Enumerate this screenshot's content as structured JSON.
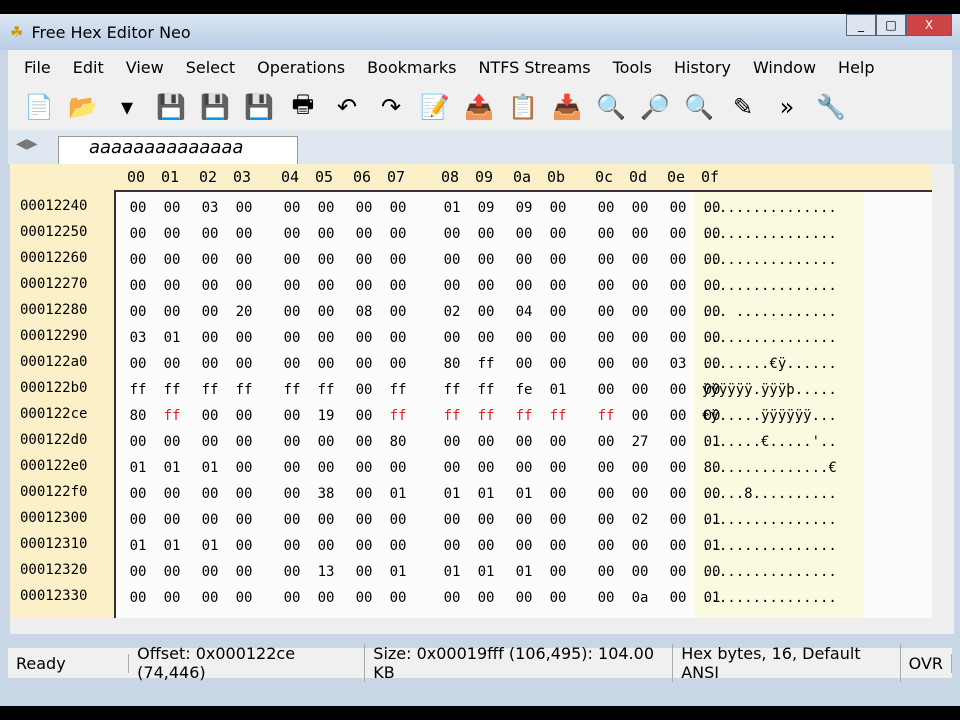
{
  "window": {
    "title": "Free Hex Editor Neo",
    "controls": [
      "_",
      "□",
      "X"
    ]
  },
  "menu": [
    "File",
    "Edit",
    "View",
    "Select",
    "Operations",
    "Bookmarks",
    "NTFS Streams",
    "Tools",
    "History",
    "Window",
    "Help"
  ],
  "toolbar": {
    "icons": [
      "new-file-icon",
      "open-folder-icon",
      "dropdown-icon",
      "save-icon",
      "save-as-icon",
      "save-all-icon",
      "print-icon",
      "undo-icon",
      "redo-icon",
      "edit-icon",
      "export-icon",
      "paste-icon",
      "import-icon",
      "find-icon",
      "find-next-icon",
      "replace-icon",
      "pen-icon",
      "more-icon",
      "settings-icon"
    ],
    "overflow": "»"
  },
  "tab": {
    "label": "aaaaaaaaaaaaaa"
  },
  "columns": [
    "00",
    "01",
    "02",
    "03",
    "04",
    "05",
    "06",
    "07",
    "08",
    "09",
    "0a",
    "0b",
    "0c",
    "0d",
    "0e",
    "0f"
  ],
  "rows": [
    {
      "addr": "00012240",
      "bytes": "00 00 03 00 00 00 00 00 01 09 09 00 00 00 00 00",
      "ascii": "................"
    },
    {
      "addr": "00012250",
      "bytes": "00 00 00 00 00 00 00 00 00 00 00 00 00 00 00 00",
      "ascii": "................"
    },
    {
      "addr": "00012260",
      "bytes": "00 00 00 00 00 00 00 00 00 00 00 00 00 00 00 00",
      "ascii": "................"
    },
    {
      "addr": "00012270",
      "bytes": "00 00 00 00 00 00 00 00 00 00 00 00 00 00 00 00",
      "ascii": "................"
    },
    {
      "addr": "00012280",
      "bytes": "00 00 00 20 00 00 08 00 02 00 04 00 00 00 00 00",
      "ascii": "... ............"
    },
    {
      "addr": "00012290",
      "bytes": "03 01 00 00 00 00 00 00 00 00 00 00 00 00 00 00",
      "ascii": "................"
    },
    {
      "addr": "000122a0",
      "bytes": "00 00 00 00 00 00 00 00 80 ff 00 00 00 00 03 00",
      "ascii": "........€ÿ......"
    },
    {
      "addr": "000122b0",
      "bytes": "ff ff ff ff ff ff 00 ff ff ff fe 01 00 00 00 00",
      "ascii": "ÿÿÿÿÿÿ.ÿÿÿþ....."
    },
    {
      "addr": "000122ce",
      "bytes": "80 ff 00 00 00 19 00 ff ff ff ff ff ff 00 00 00",
      "ascii": "€ÿ.....ÿÿÿÿÿÿ...",
      "modified": [
        1,
        7,
        8,
        9,
        10,
        11,
        12
      ]
    },
    {
      "addr": "000122d0",
      "bytes": "00 00 00 00 00 00 00 80 00 00 00 00 00 27 00 01",
      "ascii": ".......€.....'.."
    },
    {
      "addr": "000122e0",
      "bytes": "01 01 01 00 00 00 00 00 00 00 00 00 00 00 00 80",
      "ascii": "...............€"
    },
    {
      "addr": "000122f0",
      "bytes": "00 00 00 00 00 38 00 01 01 01 01 00 00 00 00 00",
      "ascii": ".....8.........."
    },
    {
      "addr": "00012300",
      "bytes": "00 00 00 00 00 00 00 00 00 00 00 00 00 02 00 01",
      "ascii": "................"
    },
    {
      "addr": "00012310",
      "bytes": "01 01 01 00 00 00 00 00 00 00 00 00 00 00 00 01",
      "ascii": "................"
    },
    {
      "addr": "00012320",
      "bytes": "00 00 00 00 00 13 00 01 01 01 01 00 00 00 00 00",
      "ascii": "................"
    },
    {
      "addr": "00012330",
      "bytes": "00 00 00 00 00 00 00 00 00 00 00 00 00 0a 00 01",
      "ascii": "................"
    }
  ],
  "status": {
    "state": "Ready",
    "offset": "Offset: 0x000122ce (74,446)",
    "size": "Size: 0x00019fff (106,495): 104.00 KB",
    "mode": "Hex bytes, 16, Default ANSI",
    "ovr": "OVR"
  },
  "colors": {
    "modified": "#dd2222",
    "header_bg": "#fbf0c8",
    "ascii_bg": "#fafae0"
  }
}
